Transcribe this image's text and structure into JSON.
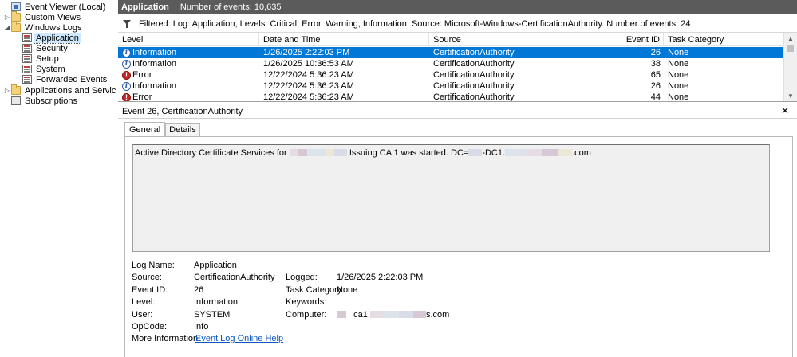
{
  "tree": {
    "items": [
      {
        "label": "Event Viewer (Local)",
        "icon": "event-viewer-icon"
      },
      {
        "label": "Custom Views",
        "icon": "folder-icon"
      },
      {
        "label": "Windows Logs",
        "icon": "folder-icon"
      },
      {
        "label": "Application",
        "icon": "log-icon",
        "selected": true
      },
      {
        "label": "Security",
        "icon": "log-icon"
      },
      {
        "label": "Setup",
        "icon": "log-icon"
      },
      {
        "label": "System",
        "icon": "log-icon"
      },
      {
        "label": "Forwarded Events",
        "icon": "log-icon"
      },
      {
        "label": "Applications and Services Lo",
        "icon": "folder-icon"
      },
      {
        "label": "Subscriptions",
        "icon": "subscriptions-icon"
      }
    ]
  },
  "header": {
    "title": "Application",
    "count": "Number of events: 10,635"
  },
  "filter": {
    "text": "Filtered: Log: Application; Levels: Critical, Error, Warning, Information; Source: Microsoft-Windows-CertificationAuthority. Number of events: 24"
  },
  "columns": {
    "level": "Level",
    "datetime": "Date and Time",
    "source": "Source",
    "eventid": "Event ID",
    "category": "Task Category"
  },
  "events": [
    {
      "level": "Information",
      "datetime": "1/26/2025 2:22:03 PM",
      "source": "CertificationAuthority",
      "eventid": "26",
      "category": "None"
    },
    {
      "level": "Information",
      "datetime": "1/26/2025 10:36:53 AM",
      "source": "CertificationAuthority",
      "eventid": "38",
      "category": "None"
    },
    {
      "level": "Error",
      "datetime": "12/22/2024 5:36:23 AM",
      "source": "CertificationAuthority",
      "eventid": "65",
      "category": "None"
    },
    {
      "level": "Information",
      "datetime": "12/22/2024 5:36:23 AM",
      "source": "CertificationAuthority",
      "eventid": "26",
      "category": "None"
    },
    {
      "level": "Error",
      "datetime": "12/22/2024 5:36:23 AM",
      "source": "CertificationAuthority",
      "eventid": "44",
      "category": "None"
    }
  ],
  "detail": {
    "title": "Event 26, CertificationAuthority",
    "close": "✕",
    "tabs": {
      "general": "General",
      "details": "Details"
    },
    "description": {
      "part1": "Active Directory Certificate Services for",
      "part2": "Issuing CA 1 was started.  DC=",
      "part3": "-DC1.",
      "part4": ".com"
    },
    "labels": {
      "log_name": "Log Name:",
      "source": "Source:",
      "event_id": "Event ID:",
      "level": "Level:",
      "user": "User:",
      "opcode": "OpCode:",
      "more_info": "More Information:",
      "logged": "Logged:",
      "task_category": "Task Category:",
      "keywords": "Keywords:",
      "computer": "Computer:"
    },
    "values": {
      "log_name": "Application",
      "source": "CertificationAuthority",
      "event_id": "26",
      "level": "Information",
      "user": "SYSTEM",
      "opcode": "Info",
      "more_info_link": "Event Log Online Help",
      "logged": "1/26/2025 2:22:03 PM",
      "task_category": "None",
      "keywords": "",
      "computer_part1": "ca1.",
      "computer_part2": "s.com"
    }
  }
}
